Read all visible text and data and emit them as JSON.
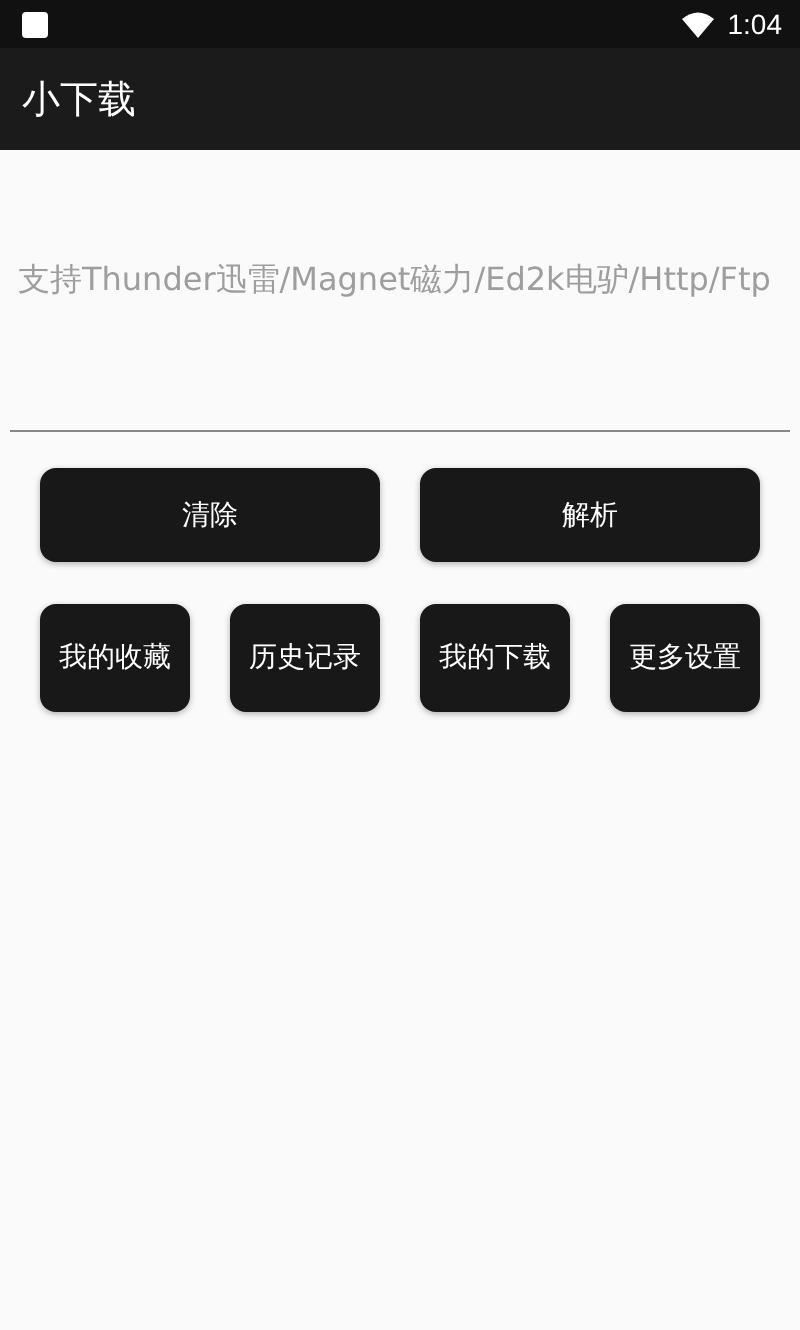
{
  "status_bar": {
    "time": "1:04"
  },
  "app_bar": {
    "title": "小下载"
  },
  "link_field": {
    "placeholder": "支持Thunder迅雷/Magnet磁力/Ed2k电驴/Http/Ftp"
  },
  "main_buttons": [
    "清除",
    "解析"
  ],
  "menu_buttons": [
    "我的收藏",
    "历史记录",
    "我的下载",
    "更多设置"
  ]
}
